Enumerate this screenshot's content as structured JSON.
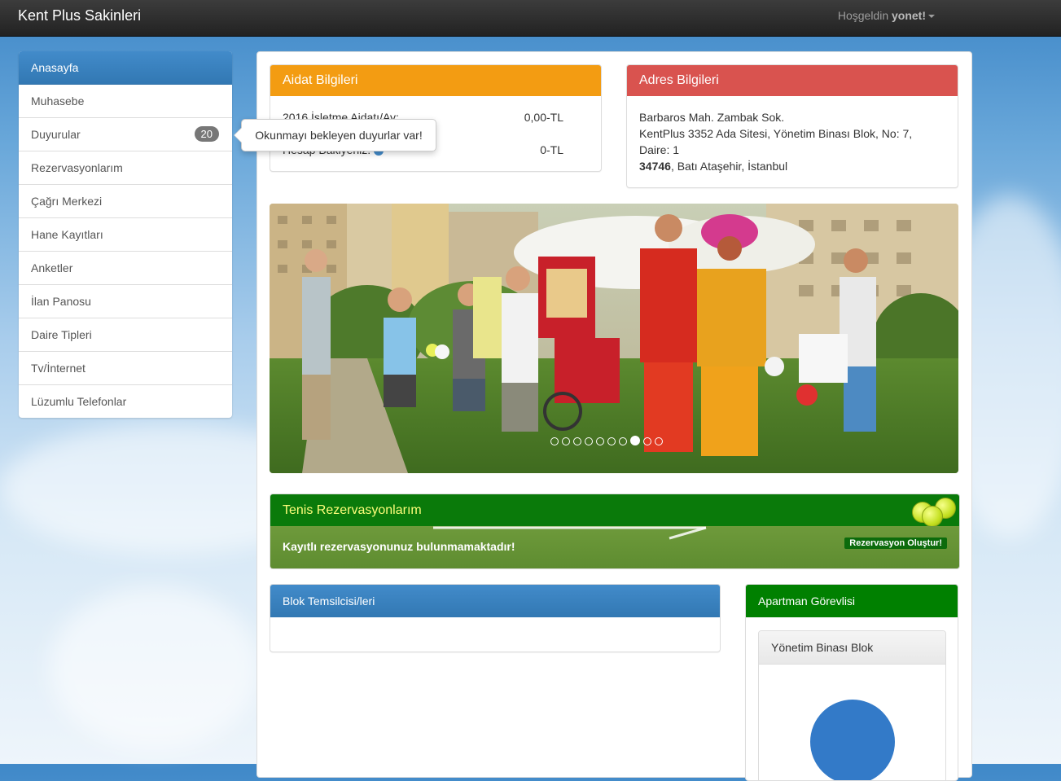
{
  "navbar": {
    "brand": "Kent Plus Sakinleri",
    "greeting": "Hoşgeldin",
    "username": "yonet!"
  },
  "sidebar": {
    "items": [
      {
        "label": "Anasayfa",
        "active": true
      },
      {
        "label": "Muhasebe"
      },
      {
        "label": "Duyurular",
        "badge": "20"
      },
      {
        "label": "Rezervasyonlarım"
      },
      {
        "label": "Çağrı Merkezi"
      },
      {
        "label": "Hane Kayıtları"
      },
      {
        "label": "Anketler"
      },
      {
        "label": "İlan Panosu"
      },
      {
        "label": "Daire Tipleri"
      },
      {
        "label": "Tv/İnternet"
      },
      {
        "label": "Lüzumlu Telefonlar"
      }
    ],
    "tooltip": "Okunmayı bekleyen duyurlar var!"
  },
  "aidat": {
    "title": "Aidat Bilgileri",
    "row1_label": "2016 İşletme Aidatı/Ay:",
    "row1_value": "0,00-TL",
    "row2_label": "Hesap Bakiyeniz:",
    "row2_value": "0-TL"
  },
  "adres": {
    "title": "Adres Bilgileri",
    "line1": "Barbaros Mah. Zambak Sok.",
    "line2": "KentPlus 3352 Ada Sitesi, Yönetim Binası Blok, No: 7,",
    "line3": "Daire: 1",
    "postal": "34746",
    "line4": ", Batı Ataşehir, İstanbul"
  },
  "carousel": {
    "slide_count": 10,
    "active_index": 7
  },
  "tenis": {
    "title": "Tenis Rezervasyonlarım",
    "message": "Kayıtlı rezervasyonunuz bulunmamaktadır!",
    "button": "Rezervasyon Oluştur!"
  },
  "blok": {
    "title": "Blok Temsilcisi/leri"
  },
  "apartman": {
    "title": "Apartman Görevlisi",
    "card_title": "Yönetim Binası Blok"
  },
  "colors": {
    "aidat": "#f39c12",
    "adres": "#d9534f",
    "primary": "#428bca",
    "success": "#008000"
  }
}
